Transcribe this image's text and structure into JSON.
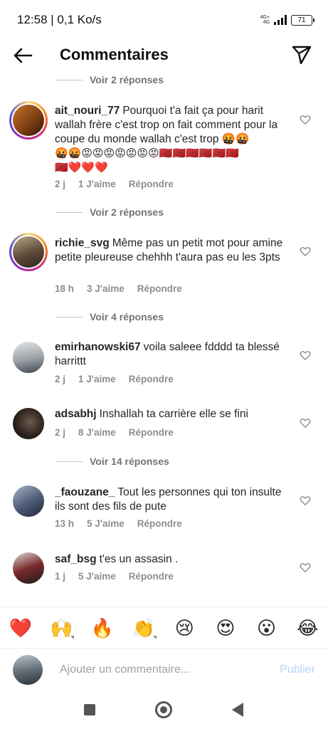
{
  "status": {
    "time_net": "12:58 | 0,1 Ko/s",
    "network_top": "4G+",
    "network_bottom": "4G",
    "battery": "71"
  },
  "header": {
    "title": "Commentaires"
  },
  "replies_top": "Voir 2 réponses",
  "comments": [
    {
      "user": "ait_nouri_77",
      "text": "Pourquoi t'a fait ça pour harit wallah frère c'est trop on fait comment pour la coupe du monde wallah c'est trop 🤬🤬",
      "emojis1": "🤬🤬😡😡😡😡😡😡😡🇲🇦🇲🇦🇲🇦🇲🇦🇲🇦🇲🇦",
      "emojis2": "🇲🇦❤️❤️❤️",
      "time": "2 j",
      "likes": "1 J'aime",
      "reply": "Répondre",
      "replies": "Voir 2 réponses"
    },
    {
      "user": "richie_svg",
      "text": "Même pas un petit mot pour amine petite pleureuse chehhh t'aura pas eu les 3pts",
      "time": "18 h",
      "likes": "3 J'aime",
      "reply": "Répondre",
      "replies": "Voir 4 réponses"
    },
    {
      "user": "emirhanowski67",
      "text": "voila saleee fdddd ta blessé harrittt",
      "time": "2 j",
      "likes": "1 J'aime",
      "reply": "Répondre"
    },
    {
      "user": "adsabhj",
      "text": "Inshallah ta carrière elle se fini",
      "time": "2 j",
      "likes": "8 J'aime",
      "reply": "Répondre",
      "replies": "Voir 14 réponses"
    },
    {
      "user": "_faouzane_",
      "text": "Tout les personnes qui ton insulte ils sont des fils de pute",
      "time": "13 h",
      "likes": "5 J'aime",
      "reply": "Répondre"
    },
    {
      "user": "saf_bsg",
      "text": "t'es un assasin .",
      "time": "1 j",
      "likes": "5 J'aime",
      "reply": "Répondre"
    }
  ],
  "reactions": [
    "❤️",
    "🙌",
    "🔥",
    "👏",
    "😢",
    "😍",
    "😮",
    "😂"
  ],
  "composer": {
    "placeholder": "Ajouter un commentaire...",
    "post": "Publier"
  },
  "colors": {
    "accent_disabled": "#b3d4fb",
    "muted": "#8e8e8e"
  }
}
